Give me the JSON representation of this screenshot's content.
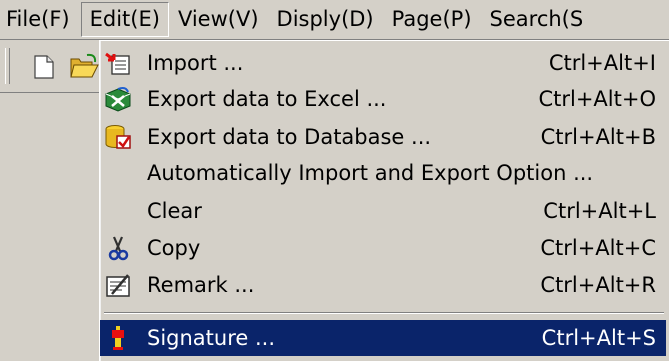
{
  "menubar": {
    "items": [
      "File(F)",
      "Edit(E)",
      "View(V)",
      "Disply(D)",
      "Page(P)",
      "Search(S"
    ],
    "active_index": 1
  },
  "toolbar": {
    "icons": [
      "new-document-icon",
      "open-folder-icon"
    ]
  },
  "edit_menu": {
    "items": [
      {
        "label": "Import ...",
        "shortcut": "Ctrl+Alt+I",
        "icon": "import-icon"
      },
      {
        "label": "Export data to Excel ...",
        "shortcut": "Ctrl+Alt+O",
        "icon": "export-excel-icon"
      },
      {
        "label": "Export data to Database ...",
        "shortcut": "Ctrl+Alt+B",
        "icon": "export-database-icon"
      },
      {
        "label": "Automatically Import and Export Option ...",
        "shortcut": "",
        "icon": ""
      },
      {
        "label": "Clear",
        "shortcut": "Ctrl+Alt+L",
        "icon": ""
      },
      {
        "label": "Copy",
        "shortcut": "Ctrl+Alt+C",
        "icon": "scissors-icon"
      },
      {
        "label": "Remark ...",
        "shortcut": "Ctrl+Alt+R",
        "icon": "remark-icon"
      },
      {
        "label": "Signature ...",
        "shortcut": "Ctrl+Alt+S",
        "icon": "signature-icon"
      }
    ],
    "selected_index": 7
  },
  "colors": {
    "face": "#d4d0c8",
    "highlight": "#0a246a"
  }
}
